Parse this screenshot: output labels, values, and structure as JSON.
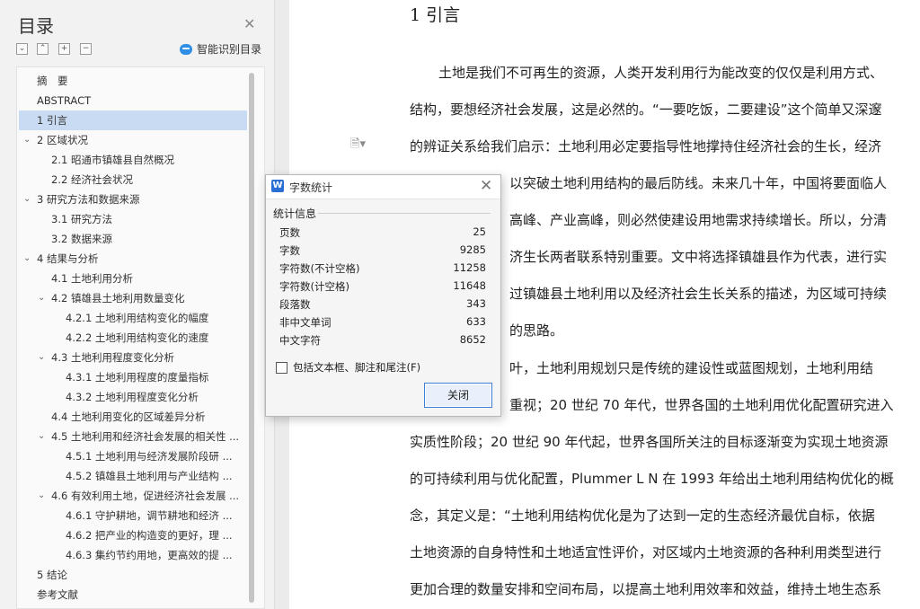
{
  "sidebar": {
    "title": "目录",
    "smart_toc_label": "智能识别目录",
    "toc": [
      {
        "label": "摘　要",
        "level": 1,
        "expandable": false
      },
      {
        "label": "ABSTRACT",
        "level": 1,
        "expandable": false
      },
      {
        "label": "1 引言",
        "level": 1,
        "expandable": false,
        "active": true
      },
      {
        "label": "2 区域状况",
        "level": 1,
        "expandable": true
      },
      {
        "label": "2.1 昭通市镇雄县自然概况",
        "level": 2,
        "expandable": false
      },
      {
        "label": "2.2 经济社会状况",
        "level": 2,
        "expandable": false
      },
      {
        "label": "3 研究方法和数据来源",
        "level": 1,
        "expandable": true
      },
      {
        "label": "3.1 研究方法",
        "level": 2,
        "expandable": false
      },
      {
        "label": "3.2 数据来源",
        "level": 2,
        "expandable": false
      },
      {
        "label": "4 结果与分析",
        "level": 1,
        "expandable": true
      },
      {
        "label": "4.1 土地利用分析",
        "level": 2,
        "expandable": false
      },
      {
        "label": "4.2 镇雄县土地利用数量变化",
        "level": 2,
        "expandable": true
      },
      {
        "label": "4.2.1 土地利用结构变化的幅度",
        "level": 3,
        "expandable": false
      },
      {
        "label": "4.2.2 土地利用结构变化的速度",
        "level": 3,
        "expandable": false
      },
      {
        "label": "4.3 土地利用程度变化分析",
        "level": 2,
        "expandable": true
      },
      {
        "label": "4.3.1 土地利用程度的度量指标",
        "level": 3,
        "expandable": false
      },
      {
        "label": "4.3.2 土地利用程度变化分析",
        "level": 3,
        "expandable": false
      },
      {
        "label": "4.4 土地利用变化的区域差异分析",
        "level": 2,
        "expandable": false
      },
      {
        "label": "4.5 土地利用和经济社会发展的相关性 ...",
        "level": 2,
        "expandable": true
      },
      {
        "label": "4.5.1 土地利用与经济发展阶段研 ...",
        "level": 3,
        "expandable": false
      },
      {
        "label": "4.5.2 镇雄县土地利用与产业结构 ...",
        "level": 3,
        "expandable": false
      },
      {
        "label": "4.6 有效利用土地，促进经济社会发展 ...",
        "level": 2,
        "expandable": true
      },
      {
        "label": "4.6.1 守护耕地，调节耕地和经济 ...",
        "level": 3,
        "expandable": false
      },
      {
        "label": "4.6.2 把产业的构造变的更好，理 ...",
        "level": 3,
        "expandable": false
      },
      {
        "label": "4.6.3 集约节约用地，更高效的提 ...",
        "level": 3,
        "expandable": false
      },
      {
        "label": "5 结论",
        "level": 1,
        "expandable": false
      },
      {
        "label": "参考文献",
        "level": 1,
        "expandable": false
      }
    ]
  },
  "document": {
    "heading": "1 引言",
    "lines": [
      "土地是我们不可再生的资源，人类开发利用行为能改变的仅仅是利用方式、",
      "结构，要想经济社会发展，这是必然的。“一要吃饭，二要建设”这个简单又深邃",
      "的辨证关系给我们启示：土地利用必定要指导性地撑持住经济社会的生长，经济",
      "以突破土地利用结构的最后防线。未来几十年，中国将要面临人",
      "高峰、产业高峰，则必然使建设用地需求持续增长。所以，分清",
      "济生长两者联系特别重要。文中将选择镇雄县作为代表，进行实",
      "过镇雄县土地利用以及经济社会生长关系的描述，为区域可持续",
      "的思路。",
      "叶，土地利用规划只是传统的建设性或蓝图规划，土地利用结",
      "重视；20 世纪 70 年代，世界各国的土地利用优化配置研究进入",
      "实质性阶段；20 世纪 90 年代起，世界各国所关注的目标逐渐变为实现土地资源",
      "的可持续利用与优化配置，Plummer L N 在 1993 年给出土地利用结构优化的概",
      "念，其定义是：“土地利用结构优化是为了达到一定的生态经济最优自标，依据",
      "土地资源的自身特性和土地适宜性评价，对区域内土地资源的各种利用类型进行",
      "更加合理的数量安排和空间布局，以提高土地利用效率和效益，维持土地生态系"
    ]
  },
  "dialog": {
    "title": "字数统计",
    "group_label": "统计信息",
    "stats": [
      {
        "label": "页数",
        "value": "25"
      },
      {
        "label": "字数",
        "value": "9285"
      },
      {
        "label": "字符数(不计空格)",
        "value": "11258"
      },
      {
        "label": "字符数(计空格)",
        "value": "11648"
      },
      {
        "label": "段落数",
        "value": "343"
      },
      {
        "label": "非中文单词",
        "value": "633"
      },
      {
        "label": "中文字符",
        "value": "8652"
      }
    ],
    "checkbox_label": "包括文本框、脚注和尾注(F)",
    "close_button": "关闭"
  }
}
